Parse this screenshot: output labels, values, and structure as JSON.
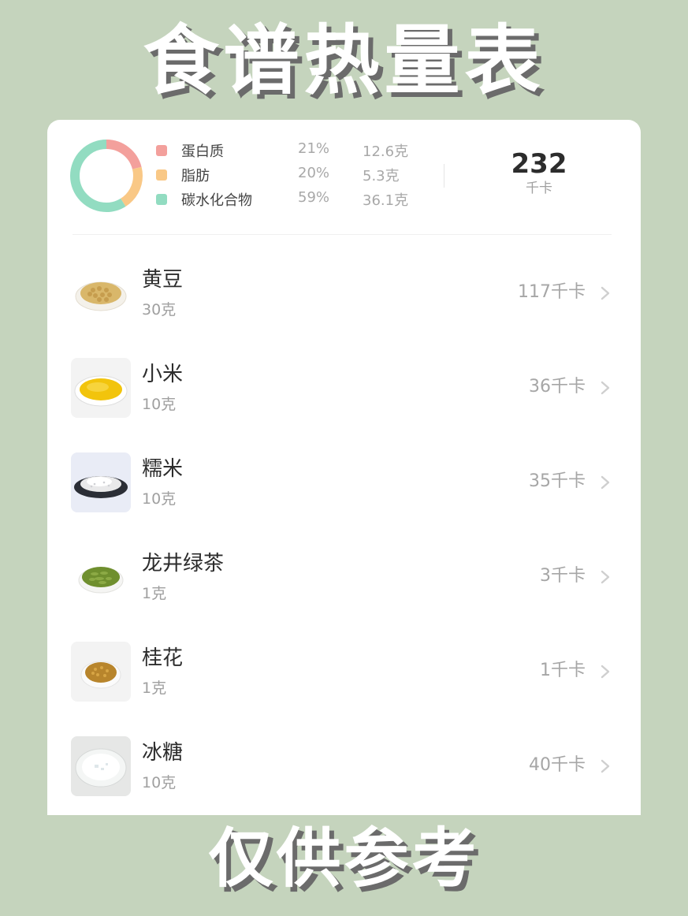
{
  "title": "食谱热量表",
  "footer": "仅供参考",
  "summary": {
    "nutrients": [
      {
        "name": "蛋白质",
        "percent": "21%",
        "grams": "12.6克",
        "color": "#f3a09c",
        "share": 0.21
      },
      {
        "name": "脂肪",
        "percent": "20%",
        "grams": "5.3克",
        "color": "#f9c886",
        "share": 0.2
      },
      {
        "name": "碳水化合物",
        "percent": "59%",
        "grams": "36.1克",
        "color": "#92dcc1",
        "share": 0.59
      }
    ],
    "total_value": "232",
    "total_unit": "千卡"
  },
  "foods": [
    {
      "name": "黄豆",
      "amount": "30克",
      "kcal": "117千卡",
      "icon": "soybean-plate-icon"
    },
    {
      "name": "小米",
      "amount": "10克",
      "kcal": "36千卡",
      "icon": "millet-plate-icon"
    },
    {
      "name": "糯米",
      "amount": "10克",
      "kcal": "35千卡",
      "icon": "glutinous-rice-plate-icon"
    },
    {
      "name": "龙井绿茶",
      "amount": "1克",
      "kcal": "3千卡",
      "icon": "green-tea-plate-icon"
    },
    {
      "name": "桂花",
      "amount": "1克",
      "kcal": "1千卡",
      "icon": "osmanthus-plate-icon"
    },
    {
      "name": "冰糖",
      "amount": "10克",
      "kcal": "40千卡",
      "icon": "rock-sugar-plate-icon"
    }
  ]
}
